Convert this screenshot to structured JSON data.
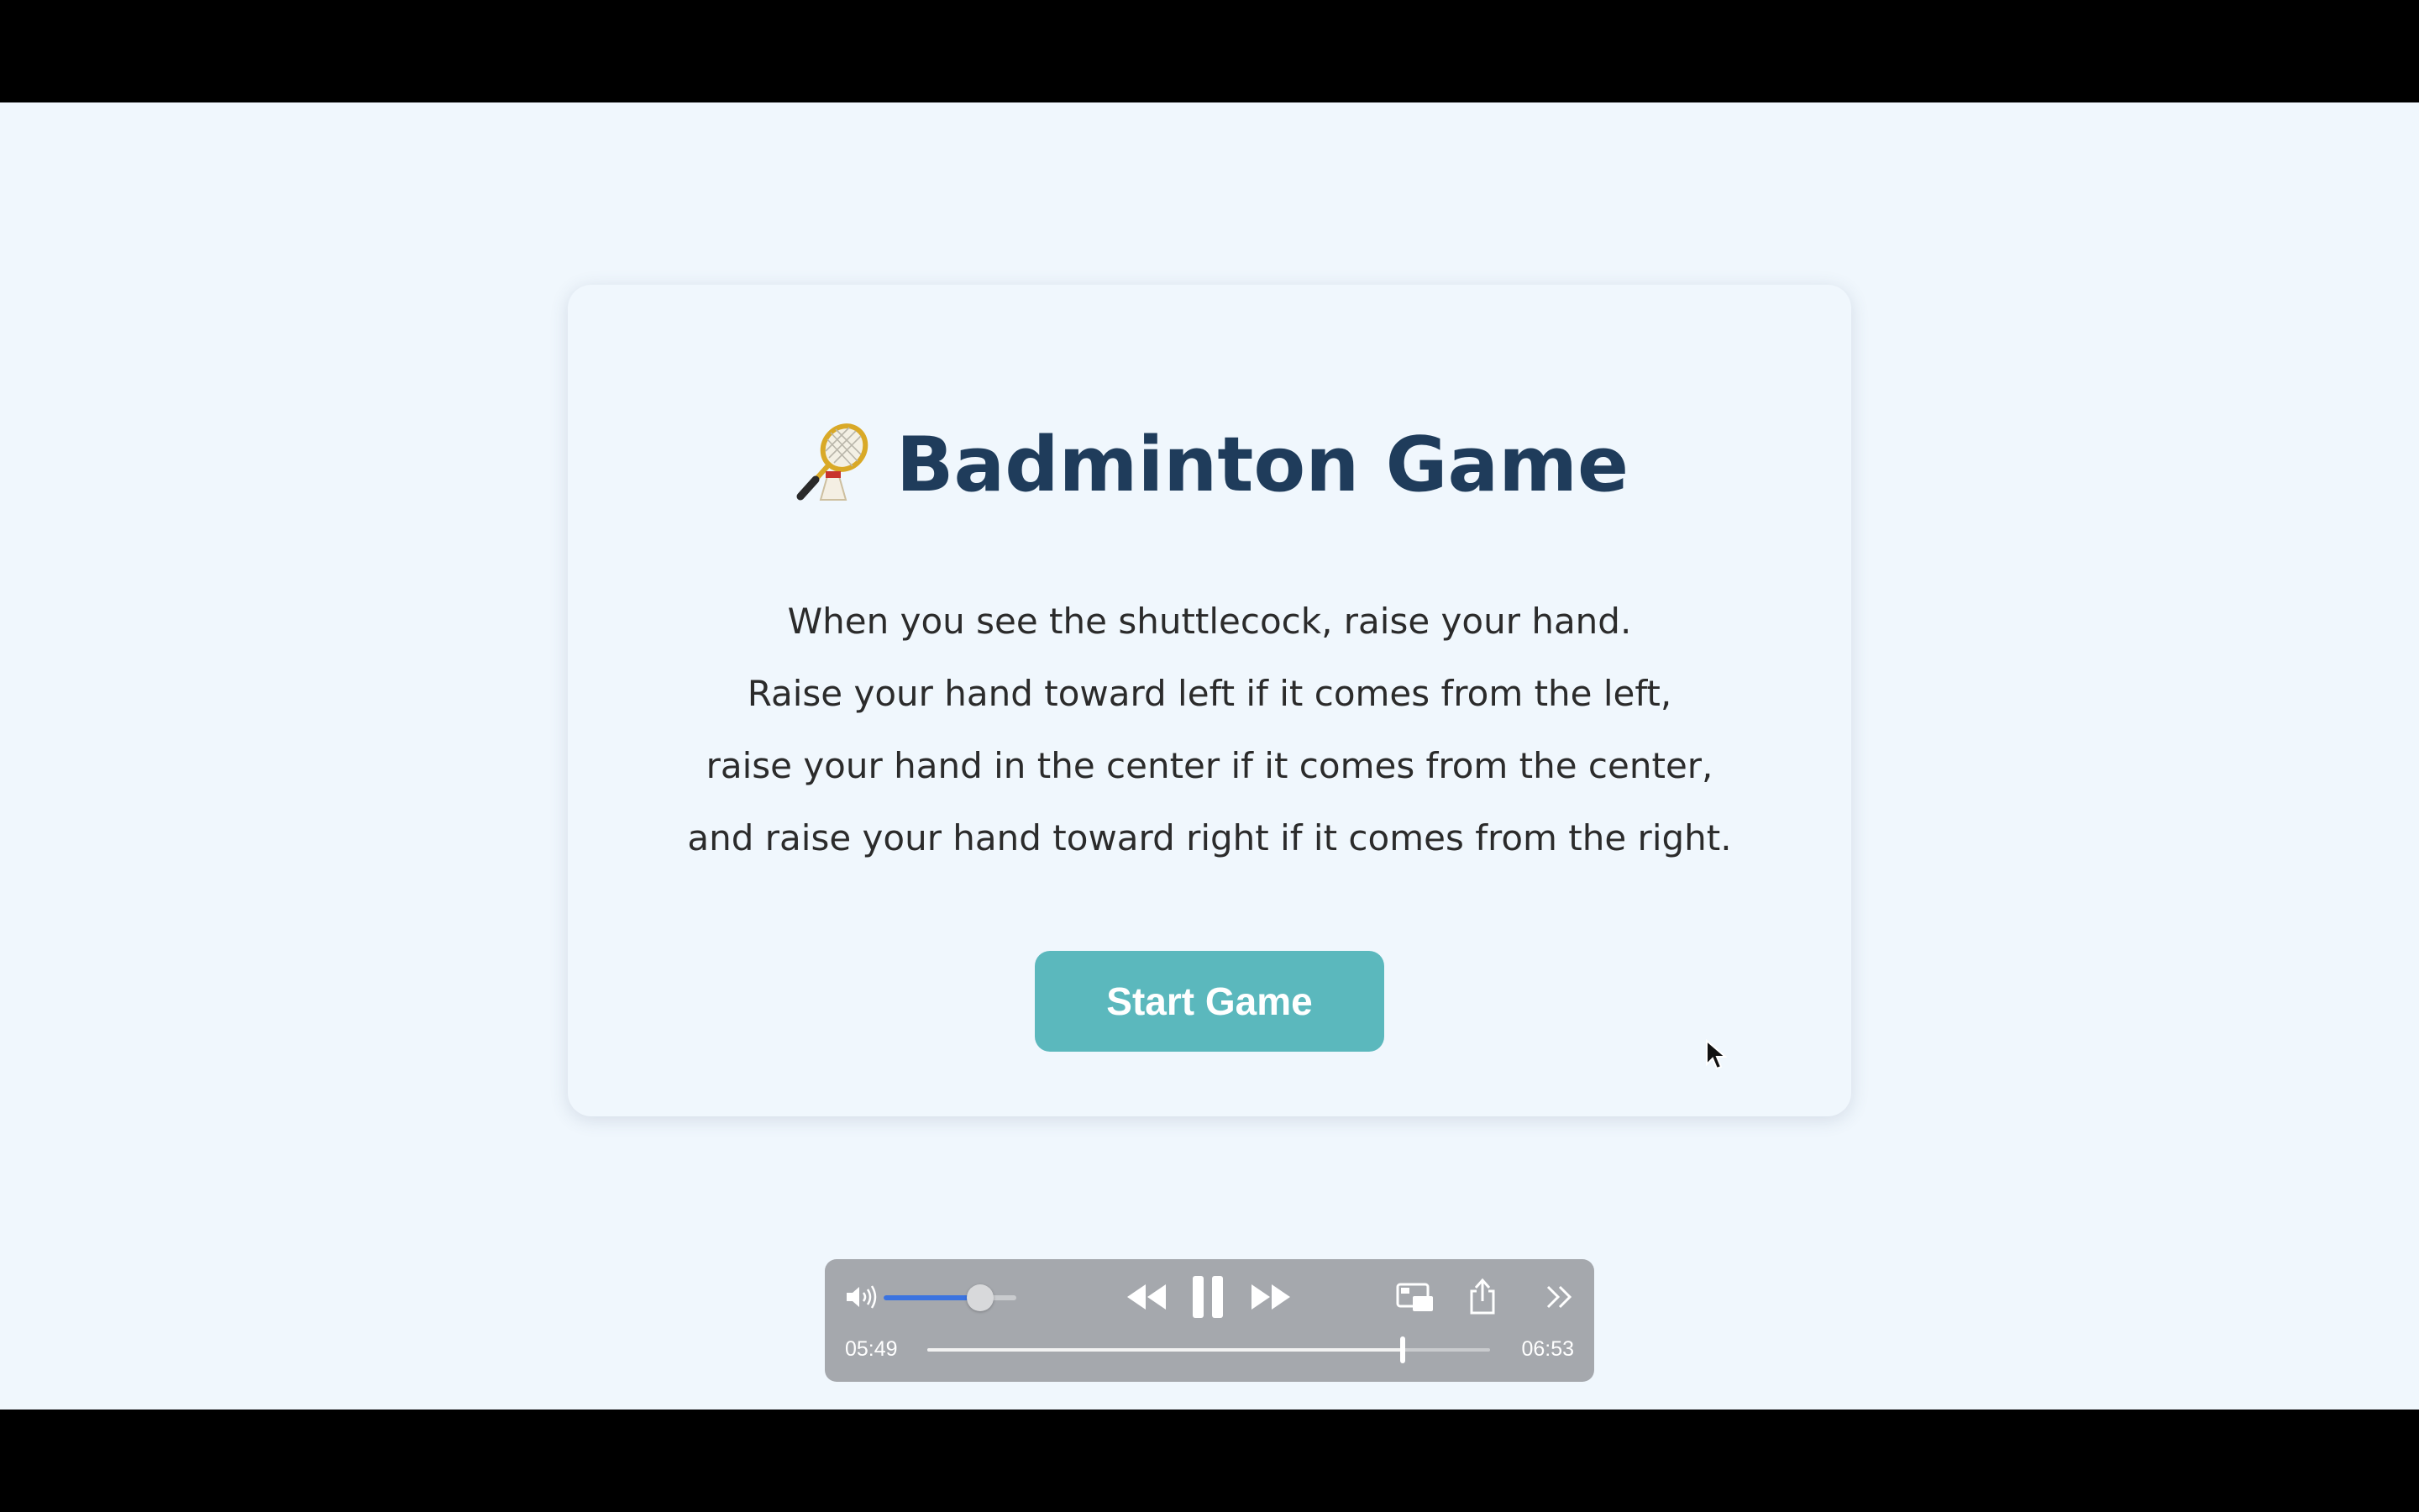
{
  "game": {
    "title": "Badminton Game",
    "title_icon": "badminton-racket-and-shuttlecock-icon",
    "instructions": [
      "When you see the shuttlecock, raise your hand.",
      "Raise your hand toward left if it comes from the left,",
      "raise your hand in the center if it comes from the center,",
      "and raise your hand toward right if it comes from the right."
    ],
    "start_button": "Start Game"
  },
  "player": {
    "elapsed": "05:49",
    "total": "06:53",
    "progress_fraction": 0.845,
    "volume_fraction": 0.73,
    "state": "playing",
    "icons": [
      "volume-icon",
      "rewind-icon",
      "pause-icon",
      "fast-forward-icon",
      "picture-in-picture-icon",
      "share-icon",
      "more-icon"
    ]
  },
  "colors": {
    "background": "#f0f7fd",
    "title": "#1f3c5b",
    "button": "#5bb8bd",
    "controls": "#a5a8ad",
    "volume_fill": "#3b73e0"
  }
}
